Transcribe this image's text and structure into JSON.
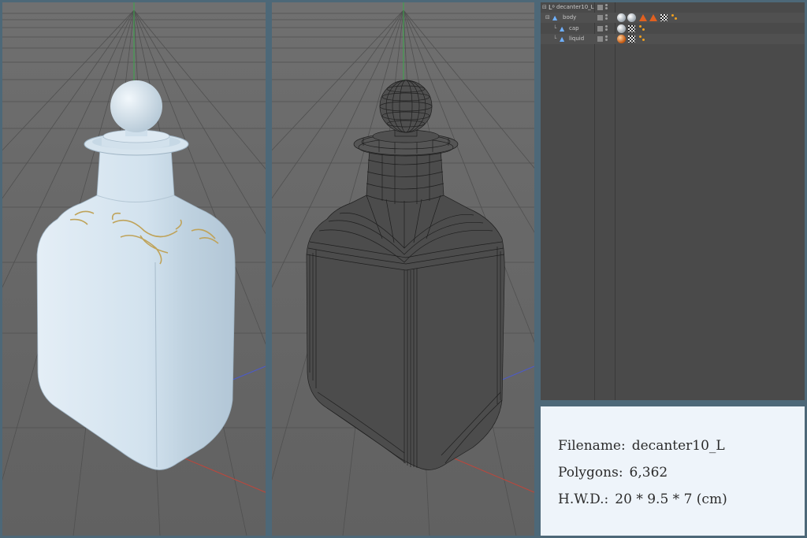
{
  "viewports": {
    "left": {
      "mode": "shaded",
      "object_color": "#c9dbe8",
      "ornament_color": "#bfa35a"
    },
    "right": {
      "mode": "wireframe",
      "object_color": "#4c4c4c",
      "wire_color": "#1f1f1f"
    }
  },
  "object_manager": {
    "rows": [
      {
        "name": "decanter10_L",
        "tags": []
      },
      {
        "name": "body",
        "tags": [
          "material-icon",
          "material-icon",
          "triangle-tag-icon",
          "triangle-tag-icon",
          "checker-tag-icon",
          "nodes-tag-icon"
        ]
      },
      {
        "name": "cap",
        "tags": [
          "material-icon",
          "checker-tag-icon",
          "nodes-tag-icon"
        ]
      },
      {
        "name": "liquid",
        "tags": [
          "material-orange-icon",
          "checker-tag-icon",
          "nodes-tag-icon"
        ]
      }
    ]
  },
  "info": {
    "filename_label": "Filename:",
    "filename_value": "decanter10_L",
    "polygons_label": "Polygons:",
    "polygons_value": "6,362",
    "hwd_label": "H.W.D.:",
    "hwd_value": "20 * 9.5 * 7 (cm)"
  },
  "colors": {
    "background": "#4d6878",
    "panel": "#4a4a4a",
    "info_bg": "#eef4fa"
  }
}
